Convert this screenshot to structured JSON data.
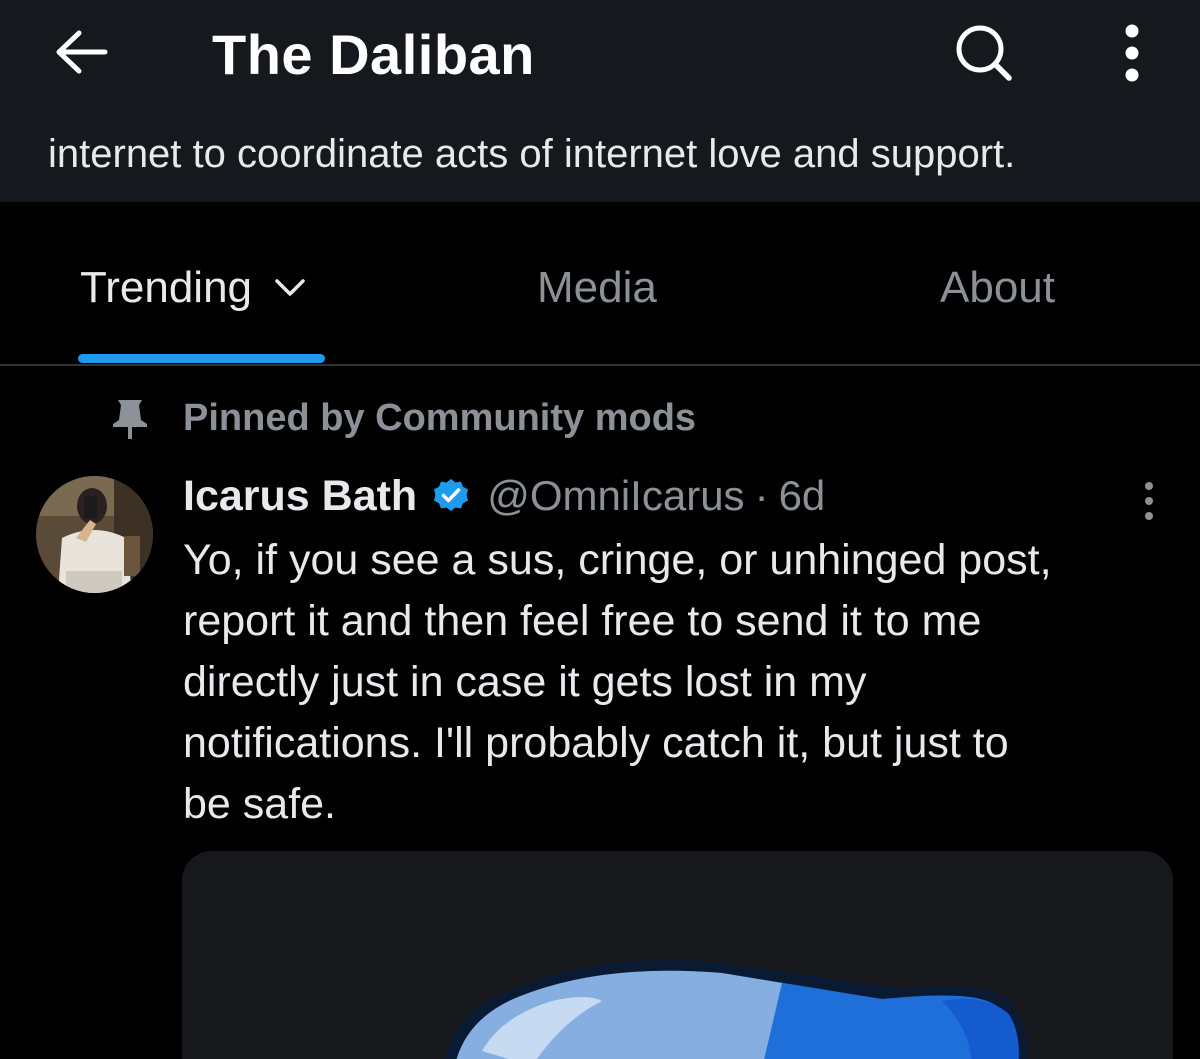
{
  "header": {
    "title": "The Daliban",
    "description": "internet to coordinate acts of internet love and support.",
    "back_icon": "arrow-left-icon",
    "search_icon": "search-icon",
    "more_icon": "more-vertical-icon"
  },
  "tabs": [
    {
      "label": "Trending",
      "active": true,
      "icon": "chevron-down-icon"
    },
    {
      "label": "Media",
      "active": false
    },
    {
      "label": "About",
      "active": false
    }
  ],
  "post": {
    "pinned_label": "Pinned by Community mods",
    "author_name": "Icarus Bath",
    "verified": true,
    "handle": "@OmniIcarus",
    "separator": "·",
    "time": "6d",
    "text_lines": [
      "Yo, if you see a sus, cringe, or unhinged post,",
      "report it and then feel free to send it to me",
      "directly just in case it gets lost in my",
      "notifications. I'll probably catch it, but just to",
      "be safe."
    ]
  },
  "colors": {
    "accent": "#1d9bf0",
    "header_bg": "#15181c",
    "background": "#000000",
    "text_primary": "#e7e9ea",
    "text_secondary": "#8b9197"
  }
}
